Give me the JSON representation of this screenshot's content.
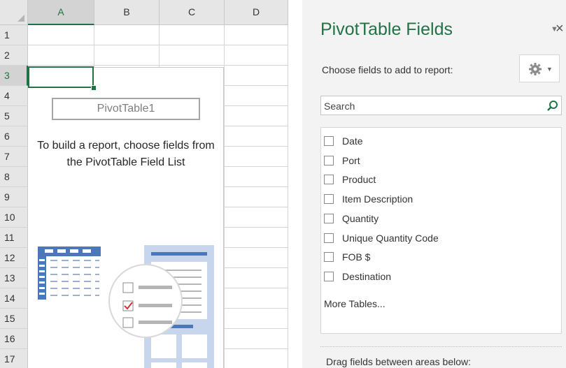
{
  "sheet": {
    "columns": [
      "A",
      "B",
      "C",
      "D"
    ],
    "rows": [
      "1",
      "2",
      "3",
      "4",
      "5",
      "6",
      "7",
      "8",
      "9",
      "10",
      "11",
      "12",
      "13",
      "14",
      "15",
      "16",
      "17"
    ],
    "active_cell": "A3"
  },
  "pivot": {
    "name": "PivotTable1",
    "message": "To build a report, choose fields from the PivotTable Field List"
  },
  "pane": {
    "title": "PivotTable Fields",
    "dropdown_icon": "chevron-down",
    "close_icon": "×",
    "subtitle": "Choose fields to add to report:",
    "search_placeholder": "Search",
    "fields": [
      {
        "label": "Date",
        "checked": false
      },
      {
        "label": "Port",
        "checked": false
      },
      {
        "label": "Product",
        "checked": false
      },
      {
        "label": "Item Description",
        "checked": false
      },
      {
        "label": "Quantity",
        "checked": false
      },
      {
        "label": "Unique Quantity Code",
        "checked": false
      },
      {
        "label": "FOB $",
        "checked": false
      },
      {
        "label": "Destination",
        "checked": false
      }
    ],
    "more_tables": "More Tables...",
    "drag_hint": "Drag fields between areas below:"
  },
  "colors": {
    "accent": "#217346",
    "illustration_blue": "#4a78b8",
    "illustration_check": "#d13438"
  }
}
